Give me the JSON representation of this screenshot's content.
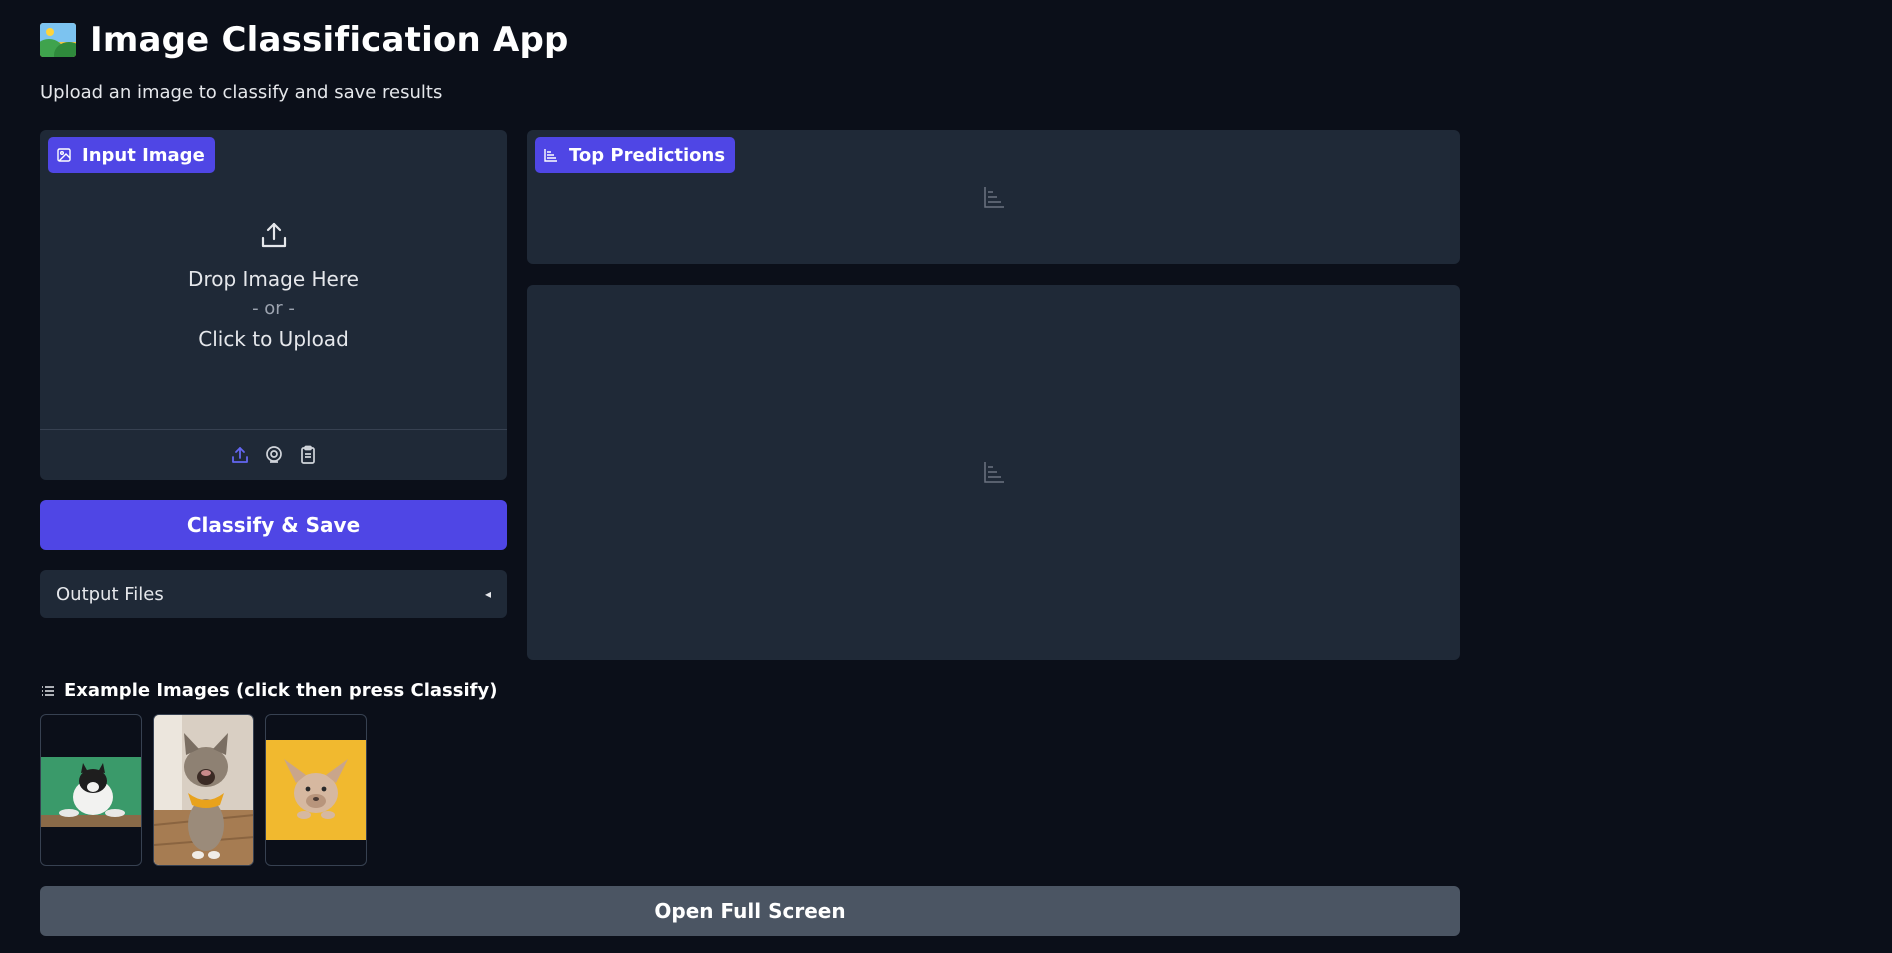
{
  "header": {
    "title": "Image Classification App",
    "title_icon": "framed-picture-emoji",
    "subtitle": "Upload an image to classify and save results"
  },
  "input_panel": {
    "label": "Input Image",
    "drop_text": "Drop Image Here",
    "or_text": "- or -",
    "click_text": "Click to Upload",
    "sources": [
      "upload-icon",
      "webcam-icon",
      "clipboard-icon"
    ]
  },
  "classify_button": {
    "label": "Classify & Save"
  },
  "output_files": {
    "label": "Output Files",
    "caret": "◂"
  },
  "predictions_panel": {
    "label": "Top Predictions"
  },
  "examples": {
    "title": "Example Images (click then press Classify)",
    "items": [
      {
        "alt": "cat on green background"
      },
      {
        "alt": "cat with yellow scarf"
      },
      {
        "alt": "french bulldog on yellow background"
      }
    ]
  },
  "fullscreen_button": {
    "label": "Open Full Screen"
  },
  "colors": {
    "background": "#0b0f19",
    "panel": "#1f2937",
    "accent": "#4f46e5",
    "secondary_button": "#4b5563"
  }
}
